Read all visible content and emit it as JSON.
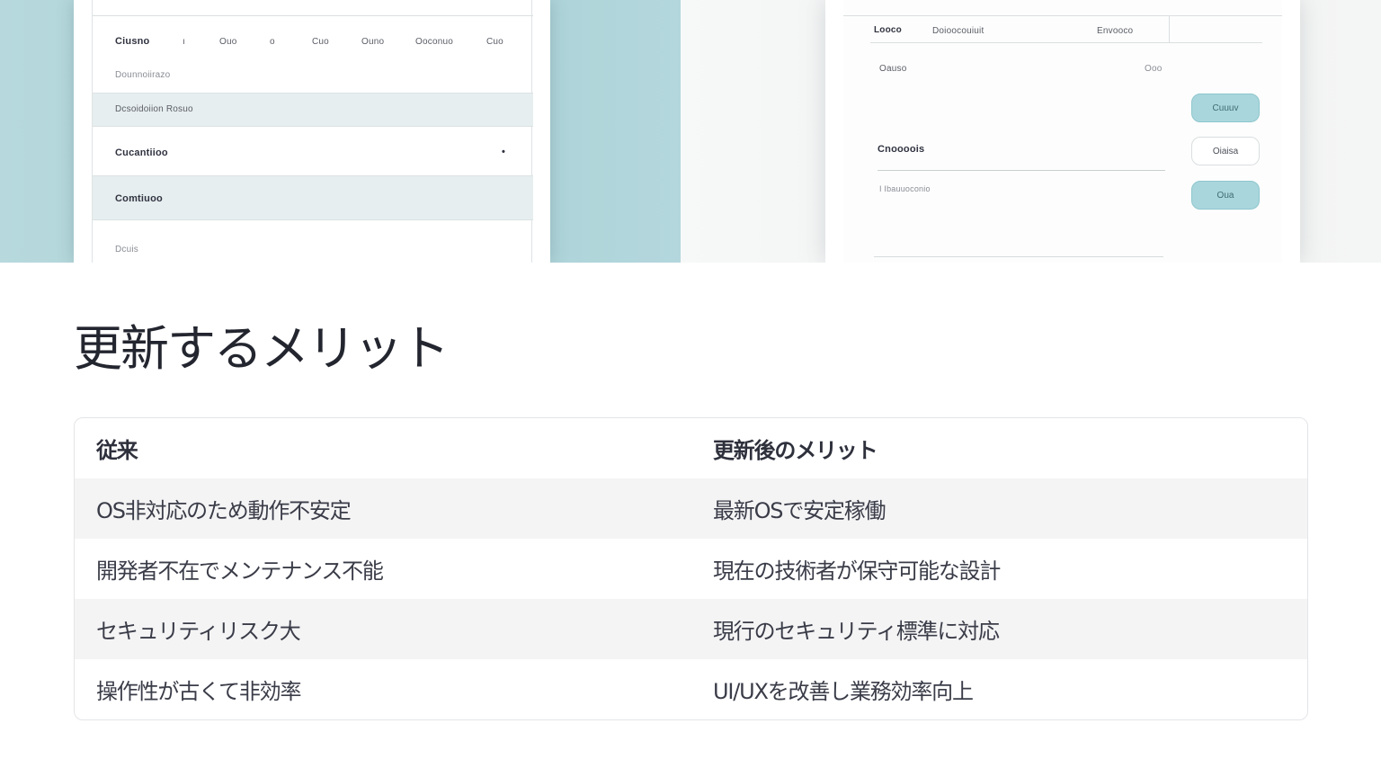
{
  "hero": {
    "left_panel": {
      "rows": [
        {
          "label": "Ciusno",
          "cols": [
            "ı",
            "Ouo",
            "o",
            "Cuo",
            "Ouno",
            "Ooconuo",
            "Cuo"
          ]
        },
        {
          "label": "Dounnoiirazo"
        },
        {
          "label": "Dcsoidoiion Rosuo"
        },
        {
          "label": "Cucantiioo",
          "marker": "•"
        },
        {
          "label": "Comtiuoo"
        },
        {
          "label": "Dcuis"
        }
      ]
    },
    "right_panel": {
      "header": [
        "Looco",
        "Doioocouiuit",
        "Envooco"
      ],
      "rows": [
        {
          "label": "Oauso",
          "value": "Ooo"
        },
        {
          "label": "Cnoooois"
        },
        {
          "label": "I Ibauuoconio"
        }
      ],
      "buttons": [
        "Cuuuv",
        "Oiaisa",
        "Oua"
      ]
    },
    "colors": {
      "teal": "#a9d2d7",
      "button_teal": "#a9d6dc"
    }
  },
  "title": "更新するメリット",
  "table": {
    "headers": [
      "従来",
      "更新後のメリット"
    ],
    "rows": [
      [
        "OS非対応のため動作不安定",
        "最新OSで安定稼働"
      ],
      [
        "開発者不在でメンテナンス不能",
        "現在の技術者が保守可能な設計"
      ],
      [
        "セキュリティリスク大",
        "現行のセキュリティ標準に対応"
      ],
      [
        "操作性が古くて非効率",
        "UI/UXを改善し業務効率向上"
      ]
    ]
  }
}
